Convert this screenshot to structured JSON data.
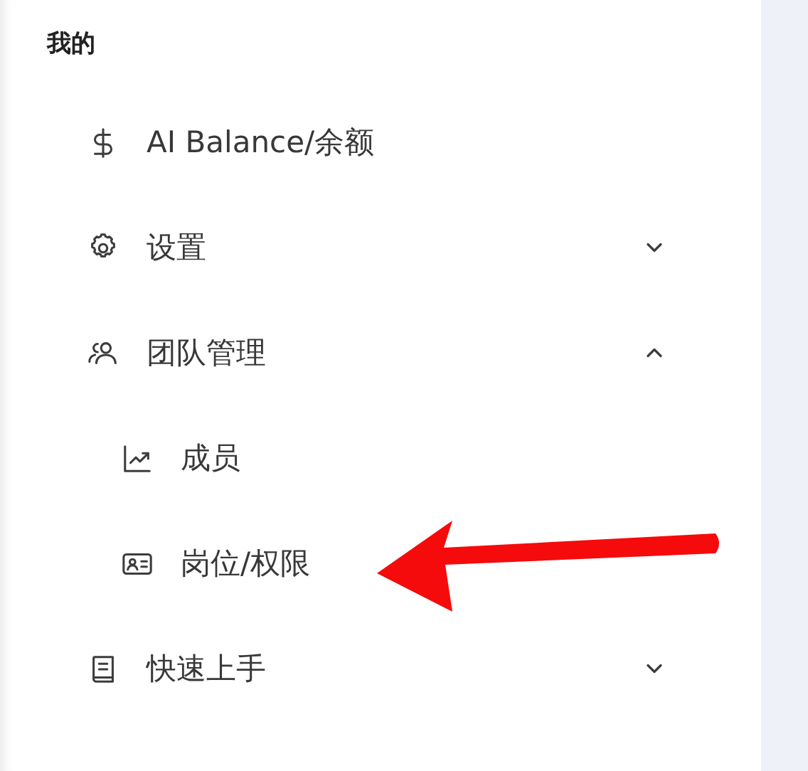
{
  "sidebar": {
    "title": "我的",
    "items": [
      {
        "label": "AI Balance/余额"
      },
      {
        "label": "设置",
        "expanded": false
      },
      {
        "label": "团队管理",
        "expanded": true,
        "children": [
          {
            "label": "成员"
          },
          {
            "label": "岗位/权限"
          }
        ]
      },
      {
        "label": "快速上手",
        "expanded": false
      }
    ]
  }
}
